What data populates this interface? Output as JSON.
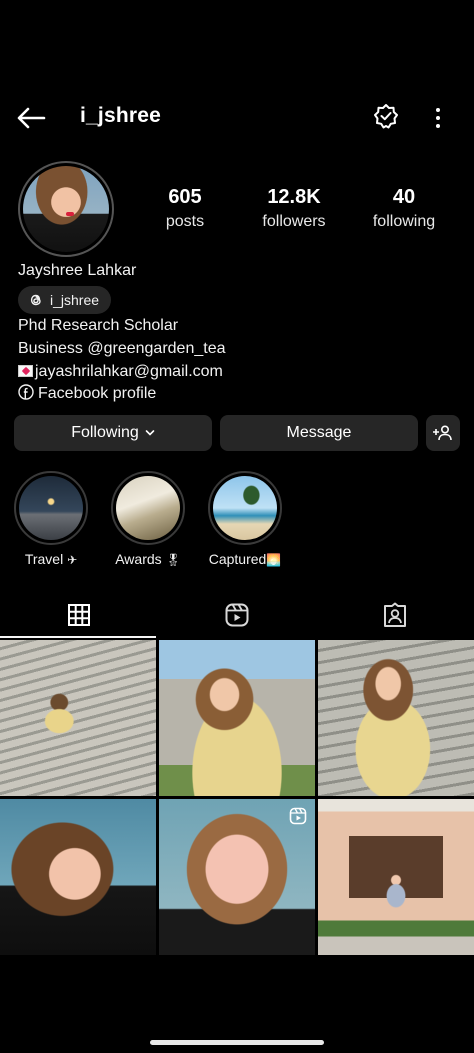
{
  "header": {
    "username": "i_jshree",
    "icons": [
      "back-arrow-icon",
      "notification-bell-icon",
      "more-options-icon"
    ]
  },
  "profile": {
    "stats": [
      {
        "value": "605",
        "label": "posts"
      },
      {
        "value": "12.8K",
        "label": "followers"
      },
      {
        "value": "40",
        "label": "following"
      }
    ],
    "name": "Jayshree Lahkar",
    "threads_handle": "i_jshree",
    "bio_line1": "Phd Research Scholar",
    "bio_line2": "Business @greengarden_tea",
    "email": "jayashrilahkar@gmail.com",
    "facebook_link": "Facebook profile"
  },
  "actions": {
    "following_label": "Following",
    "message_label": "Message"
  },
  "highlights": [
    {
      "label": "Travel",
      "emoji": "✈"
    },
    {
      "label": "Awards",
      "emoji": "🎖"
    },
    {
      "label": "Captured",
      "emoji": "🌅"
    }
  ],
  "tabs": [
    "grid-icon",
    "reels-icon",
    "tagged-icon"
  ],
  "colors": {
    "background": "#000000",
    "button": "#262626",
    "text": "#f5f5f5"
  }
}
